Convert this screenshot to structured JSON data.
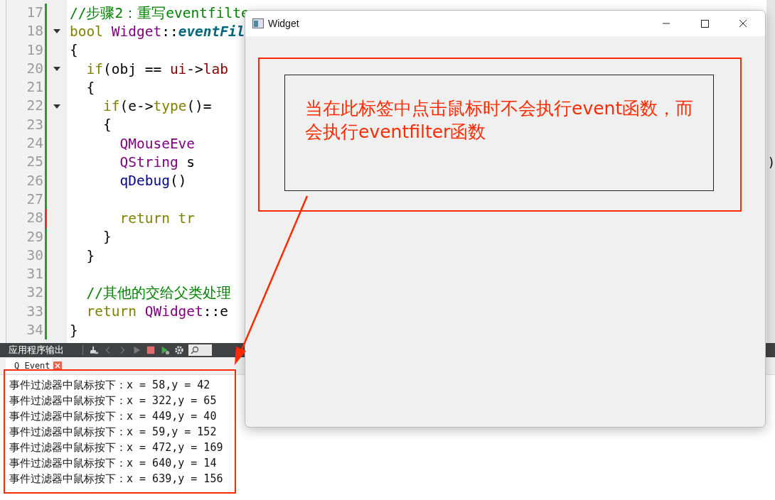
{
  "editor": {
    "lines": [
      {
        "number": "17",
        "fold": false,
        "changed": false,
        "tokens": [
          {
            "text": "//步骤2：重写eventfilte",
            "kind": "comment"
          }
        ]
      },
      {
        "number": "18",
        "fold": true,
        "changed": false,
        "tokens": [
          {
            "text": "bool ",
            "kind": "keyword"
          },
          {
            "text": "Widget",
            "kind": "type"
          },
          {
            "text": "::",
            "kind": "plain"
          },
          {
            "text": "eventFil",
            "kind": "method"
          }
        ]
      },
      {
        "number": "19",
        "fold": false,
        "changed": false,
        "tokens": [
          {
            "text": "{",
            "kind": "plain"
          }
        ]
      },
      {
        "number": "20",
        "fold": true,
        "changed": false,
        "tokens": [
          {
            "text": "    if",
            "kind": "keyword"
          },
          {
            "text": "(obj == ",
            "kind": "plain"
          },
          {
            "text": "ui",
            "kind": "member"
          },
          {
            "text": "->",
            "kind": "plain"
          },
          {
            "text": "lab",
            "kind": "member"
          }
        ]
      },
      {
        "number": "21",
        "fold": false,
        "changed": false,
        "tokens": [
          {
            "text": "    {",
            "kind": "plain"
          }
        ]
      },
      {
        "number": "22",
        "fold": true,
        "changed": false,
        "tokens": [
          {
            "text": "        if",
            "kind": "keyword"
          },
          {
            "text": "(e->",
            "kind": "plain"
          },
          {
            "text": "type",
            "kind": "keyword"
          },
          {
            "text": "()=",
            "kind": "plain"
          }
        ]
      },
      {
        "number": "23",
        "fold": false,
        "changed": false,
        "tokens": [
          {
            "text": "        {",
            "kind": "plain"
          }
        ]
      },
      {
        "number": "24",
        "fold": false,
        "changed": false,
        "tokens": [
          {
            "text": "            QMouseEve",
            "kind": "type"
          }
        ]
      },
      {
        "number": "25",
        "fold": false,
        "changed": false,
        "tokens": [
          {
            "text": "            QString",
            "kind": "type"
          },
          {
            "text": " s",
            "kind": "plain"
          }
        ],
        "tail": ")"
      },
      {
        "number": "26",
        "fold": false,
        "changed": false,
        "tokens": [
          {
            "text": "            qDebug",
            "kind": "call"
          },
          {
            "text": "()",
            "kind": "plain"
          }
        ]
      },
      {
        "number": "27",
        "fold": false,
        "changed": false
      },
      {
        "number": "28",
        "fold": false,
        "changed": true,
        "tokens": [
          {
            "text": "            return tr",
            "kind": "keyword"
          }
        ]
      },
      {
        "number": "29",
        "fold": false,
        "changed": false,
        "tokens": [
          {
            "text": "        }",
            "kind": "plain"
          }
        ]
      },
      {
        "number": "30",
        "fold": false,
        "changed": false,
        "tokens": [
          {
            "text": "    }",
            "kind": "plain"
          }
        ]
      },
      {
        "number": "31",
        "fold": false,
        "changed": false
      },
      {
        "number": "32",
        "fold": false,
        "changed": false,
        "tokens": [
          {
            "text": "    //其他的交给父类处理",
            "kind": "comment"
          }
        ]
      },
      {
        "number": "33",
        "fold": false,
        "changed": false,
        "tokens": [
          {
            "text": "    return ",
            "kind": "keyword"
          },
          {
            "text": "QWidget",
            "kind": "type"
          },
          {
            "text": "::e",
            "kind": "plain"
          }
        ]
      },
      {
        "number": "34",
        "fold": false,
        "changed": false,
        "tokens": [
          {
            "text": "}",
            "kind": "plain"
          }
        ]
      }
    ]
  },
  "output_pane": {
    "title": "应用程序输出",
    "tab": {
      "label": "Q Event",
      "selected": true
    },
    "lines": [
      "事件过滤器中鼠标按下：x = 58,y = 42",
      "事件过滤器中鼠标按下：x = 322,y = 65",
      "事件过滤器中鼠标按下：x = 449,y = 40",
      "事件过滤器中鼠标按下：x = 59,y = 152",
      "事件过滤器中鼠标按下：x = 472,y = 169",
      "事件过滤器中鼠标按下：x = 640,y = 14",
      "事件过滤器中鼠标按下：x = 639,y = 156"
    ]
  },
  "window": {
    "title": "Widget",
    "label": "当在此标签中点击鼠标时不会执行event函数，而会执行eventfilter函数"
  }
}
